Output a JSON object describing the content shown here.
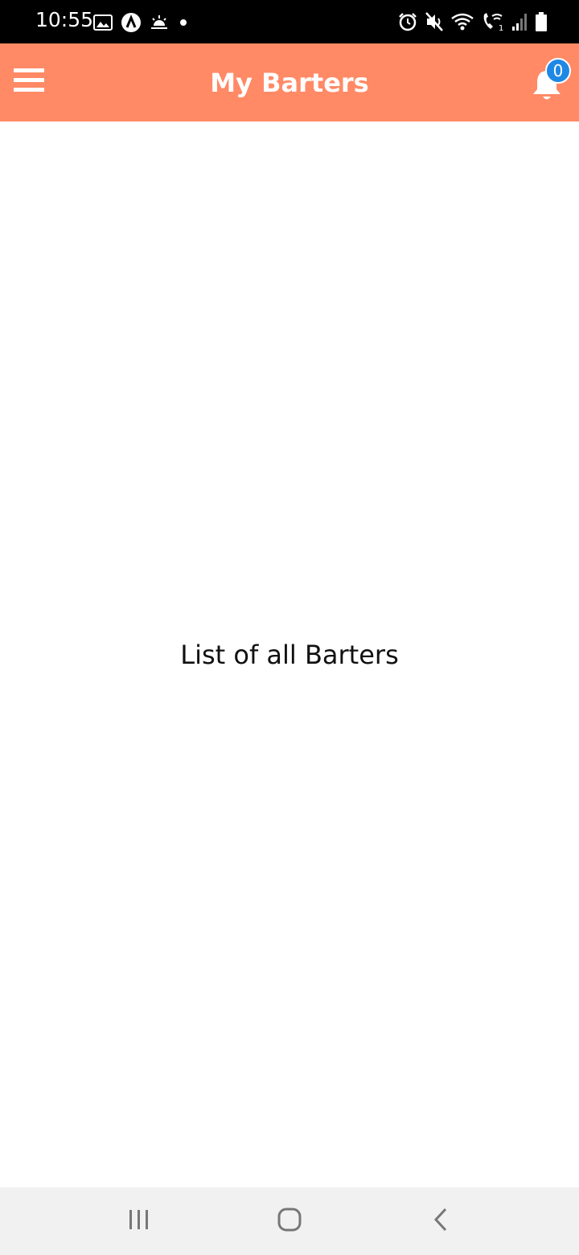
{
  "status_bar": {
    "time": "10:55",
    "left_icons": [
      "gallery-icon",
      "app-a-icon",
      "weather-sunrise-icon",
      "dot-icon"
    ],
    "right_icons": [
      "alarm-icon",
      "mute-icon",
      "wifi-icon",
      "wifi-calling-icon",
      "signal-icon",
      "battery-icon"
    ]
  },
  "app_bar": {
    "title": "My Barters",
    "background": "#FF8A65",
    "notification_count": "0",
    "badge_color": "#1E88E5"
  },
  "main": {
    "empty_message": "List of all Barters"
  },
  "nav_bar": {
    "buttons": [
      "recents-icon",
      "home-icon",
      "back-icon"
    ]
  }
}
